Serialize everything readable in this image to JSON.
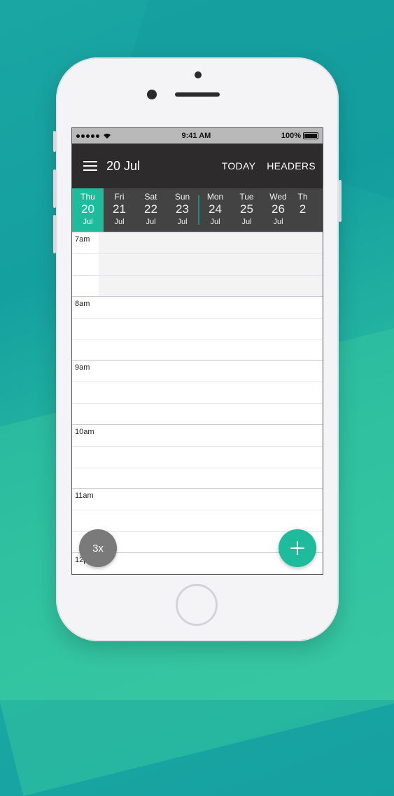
{
  "status": {
    "time": "9:41 AM",
    "battery": "100%"
  },
  "appbar": {
    "title": "20 Jul",
    "actions": [
      "TODAY",
      "HEADERS"
    ]
  },
  "days": [
    {
      "name": "Thu",
      "num": "20",
      "month": "Jul",
      "active": true
    },
    {
      "name": "Fri",
      "num": "21",
      "month": "Jul"
    },
    {
      "name": "Sat",
      "num": "22",
      "month": "Jul"
    },
    {
      "name": "Sun",
      "num": "23",
      "month": "Jul"
    },
    {
      "name": "Mon",
      "num": "24",
      "month": "Jul"
    },
    {
      "name": "Tue",
      "num": "25",
      "month": "Jul"
    },
    {
      "name": "Wed",
      "num": "26",
      "month": "Jul"
    },
    {
      "name": "Th",
      "num": "2",
      "month": ""
    }
  ],
  "hours": [
    "7am",
    "8am",
    "9am",
    "10am",
    "11am",
    "12p"
  ],
  "zoom_label": "3x",
  "colors": {
    "accent": "#1ebc9c",
    "appbar": "#2d2b2c",
    "daystrip": "#434343"
  }
}
